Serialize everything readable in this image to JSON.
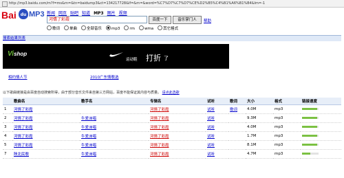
{
  "browser": {
    "address": "http://mp3.baidu.com/m?f=ms&rn=&tn=baidump3&ct=134217728&lf=&rn=&word=%C7%D7%C7%D7%CE%D2%B5%C4%B1%A6%B1%B4&lm=-1"
  },
  "logo": {
    "bai": "Bai",
    "paw": "du",
    "mp3": "MP3"
  },
  "nav": {
    "items": [
      "新闻",
      "网页",
      "贴吧",
      "知道",
      "MP3",
      "图片",
      "视频"
    ],
    "current": "MP3"
  },
  "search": {
    "query": "河情了彩霞",
    "button": "百度一下",
    "button2": "音乐掌门人",
    "help": "帮助"
  },
  "formats": {
    "items": [
      "歌词",
      "单曲",
      "全部音乐",
      "mp3",
      "rm",
      "wma",
      "其它格式"
    ],
    "selected": "mp3"
  },
  "bar": {
    "label": "搜索结果列表"
  },
  "banner": {
    "brand": "Vi",
    "brand2": "shop",
    "small": "运动鞋",
    "big": "打折",
    "le": "了"
  },
  "promos": {
    "link1": "相约情人节",
    "link2": "2010广东情歌选"
  },
  "notice": {
    "text": "以下歌曲链接是由百度自动搜索所得，由于部分音乐文件来自第三方网站，百度不能保证其内容与质量。",
    "link": "请点此选歌"
  },
  "table": {
    "headers": [
      "",
      "歌曲名",
      "歌手名",
      "专辑名",
      "试听",
      "歌词",
      "大小",
      "格式",
      "链接速度"
    ],
    "rows": [
      {
        "n": "1",
        "song": "河情了彩霞",
        "artist": "",
        "album": "河情了彩霞",
        "listen": "试听",
        "lyric": "歌词",
        "size": "4.0M",
        "format": "mp3",
        "speed": 0.9
      },
      {
        "n": "2",
        "song": "河情了彩霞",
        "artist": "牛爱洲唱",
        "album": "河情了彩霞",
        "listen": "试听",
        "lyric": "",
        "size": "9.3M",
        "format": "mp3",
        "speed": 0.9
      },
      {
        "n": "3",
        "song": "河情了彩霞",
        "artist": "牛爱洲唱",
        "album": "河情了彩霞",
        "listen": "试听",
        "lyric": "",
        "size": "4.0M",
        "format": "mp3",
        "speed": 0.9
      },
      {
        "n": "4",
        "song": "河情了彩霞",
        "artist": "牛爱洲唱",
        "album": "河情了彩霞",
        "listen": "试听",
        "lyric": "",
        "size": "1.7M",
        "format": "mp3",
        "speed": 0.9
      },
      {
        "n": "5",
        "song": "河情了彩霞",
        "artist": "牛爱洲唱",
        "album": "河情了彩霞",
        "listen": "试听",
        "lyric": "",
        "size": "8.1M",
        "format": "mp3",
        "speed": 0.9
      },
      {
        "n": "7",
        "song": "陕北民歌",
        "artist": "牛爱洲唱",
        "album": "河情了彩霞",
        "listen": "试听",
        "lyric": "",
        "size": "4.7M",
        "format": "mp3",
        "speed": 0.5
      }
    ]
  }
}
